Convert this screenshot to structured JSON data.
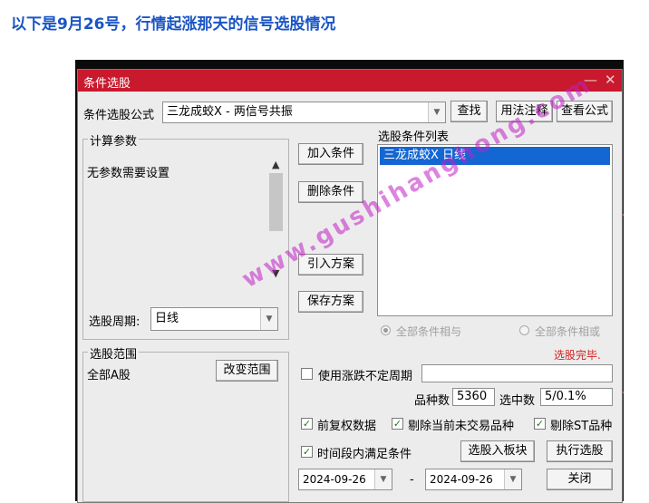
{
  "heading": "以下是9月26号，行情起涨那天的信号选股情况",
  "dialog": {
    "title": "条件选股",
    "title_controls": {
      "minimize": "—",
      "close": "✕"
    },
    "formula_label": "条件选股公式",
    "formula_value": "三龙成蛟X  -  两信号共振",
    "buttons": {
      "find": "查找",
      "usage": "用法注释",
      "view_formula": "查看公式",
      "add_condition": "加入条件",
      "delete_condition": "删除条件",
      "import_plan": "引入方案",
      "save_plan": "保存方案",
      "change_scope": "改变范围",
      "select_to_block": "选股入板块",
      "execute": "执行选股",
      "close": "关闭"
    },
    "params_group_title": "计算参数",
    "params_text": "无参数需要设置",
    "period_label": "选股周期:",
    "period_value": "日线",
    "conditions_list_title": "选股条件列表",
    "conditions": [
      "三龙成蛟X  日线"
    ],
    "logic": {
      "all_and": "全部条件相与",
      "all_or": "全部条件相或"
    },
    "status": "选股完毕.",
    "scope_group_title": "选股范围",
    "scope_value": "全部A股",
    "uncertain_period_label": "使用涨跌不定周期",
    "count_label": "品种数",
    "count_value": "5360",
    "selected_label": "选中数",
    "selected_value": "5/0.1%",
    "checks": {
      "forward_adjust": "前复权数据",
      "exclude_untraded": "剔除当前未交易品种",
      "exclude_st": "剔除ST品种",
      "time_range": "时间段内满足条件"
    },
    "date_from": "2024-09-26",
    "date_sep": "-",
    "date_to": "2024-09-26"
  },
  "watermark": "www.gushihanghong.com",
  "colors": {
    "titlebar": "#c8192d",
    "selection": "#1467d3",
    "heading": "#1a55c4",
    "status": "#d42020",
    "watermark": "#c21fc7"
  }
}
